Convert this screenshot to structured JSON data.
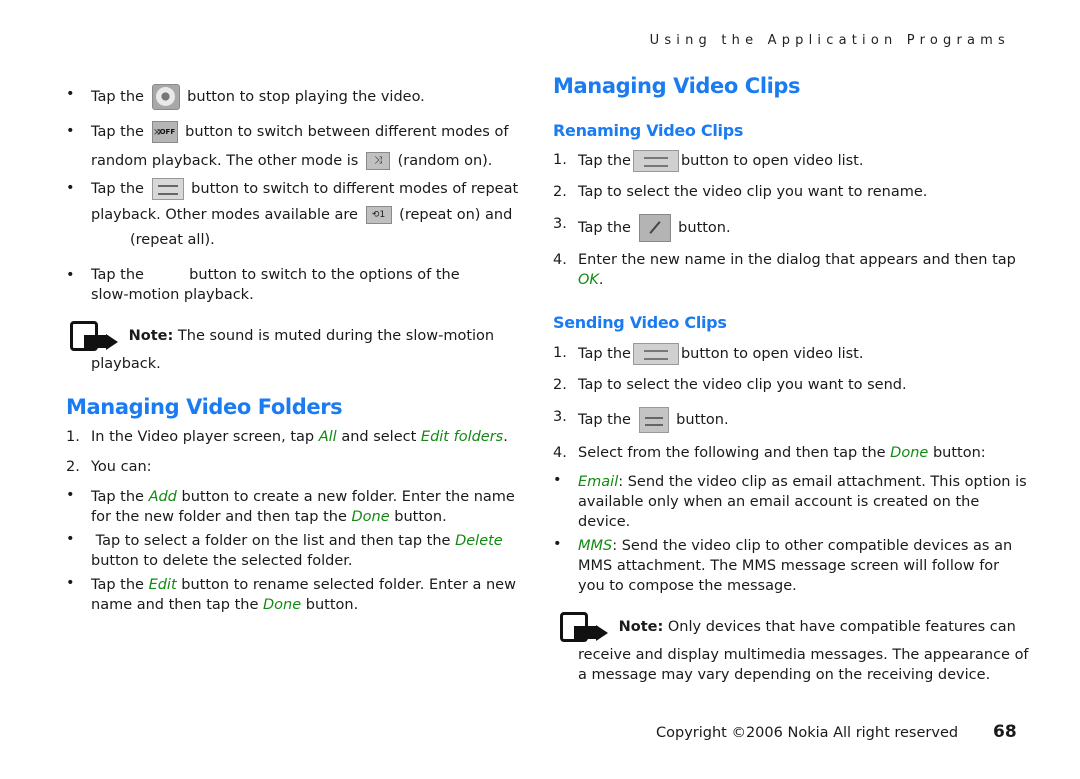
{
  "header": {
    "running_title": "Using the Application Programs"
  },
  "left": {
    "bullets_top": [
      {
        "pre": "Tap the",
        "icon": "stop-button-icon",
        "post": "button to stop playing the video."
      },
      {
        "pre": "Tap the",
        "icon": "random-off-icon",
        "icon_text": "⤨OFF",
        "post": "button to switch between different modes of",
        "line2_pre": "random playback. The other mode is",
        "icon2": "random-on-icon",
        "icon2_text": "⤨",
        "line2_post": "(random on)."
      },
      {
        "pre": "Tap the",
        "icon": "repeat-mode-icon",
        "post": "button to switch to different modes of repeat",
        "line2_pre": "playback. Other modes available are",
        "icon2": "repeat-on-icon",
        "icon2_text": "⟲1",
        "line2_post": "(repeat on) and",
        "line3": "(repeat all)."
      },
      {
        "pre": "Tap the",
        "post": "button to switch to the options of the",
        "line2": "slow-motion playback."
      }
    ],
    "note": {
      "label": "Note:",
      "text": "The sound is muted during the slow-motion",
      "text2": "playback."
    },
    "folders": {
      "title": "Managing Video Folders",
      "steps": [
        {
          "num": "1.",
          "pre": "In the Video player screen, tap",
          "em1": "All",
          "mid": "and select",
          "em2": "Edit folders",
          "post": "."
        },
        {
          "num": "2.",
          "text": "You can:"
        }
      ],
      "bullets": [
        {
          "pre": "Tap the",
          "em": "Add",
          "post": "button to create a new folder. Enter the name",
          "line2_pre": "for the new folder and then tap the",
          "em2": "Done",
          "line2_post": "button."
        },
        {
          "pre": "Tap to select a folder on the list and then tap the",
          "em": "Delete",
          "line2": "button to delete the selected folder."
        },
        {
          "pre": "Tap the",
          "em": "Edit",
          "post": "button to rename selected folder. Enter a new",
          "line2_pre": "name and then tap the",
          "em2": "Done",
          "line2_post": "button."
        }
      ]
    }
  },
  "right": {
    "title": "Managing Video Clips",
    "renaming": {
      "title": "Renaming Video Clips",
      "steps": [
        {
          "num": "1.",
          "pre": "Tap the",
          "icon": "video-list-icon",
          "post": "button to open video list."
        },
        {
          "num": "2.",
          "text": "Tap to select the video clip you want to rename."
        },
        {
          "num": "3.",
          "pre": "Tap the",
          "icon": "edit-pencil-icon",
          "post": "button."
        },
        {
          "num": "4.",
          "text": "Enter the new name in the dialog that appears and then tap",
          "em": "OK",
          "post": "."
        }
      ]
    },
    "sending": {
      "title": "Sending Video Clips",
      "steps": [
        {
          "num": "1.",
          "pre": "Tap the",
          "icon": "video-list-icon",
          "post": "button to open video list."
        },
        {
          "num": "2.",
          "text": "Tap to select the video clip you want to send."
        },
        {
          "num": "3.",
          "pre": "Tap the",
          "icon": "send-icon",
          "post": "button."
        },
        {
          "num": "4.",
          "pre": "Select from the following and then tap the",
          "em": "Done",
          "post": "button:"
        }
      ],
      "options": [
        {
          "em": "Email",
          "text": ": Send the video clip as email attachment. This option is",
          "line2": "available only when an email account is created on the",
          "line3": "device."
        },
        {
          "em": "MMS",
          "text": ": Send the video clip to other compatible devices as an",
          "line2": "MMS attachment. The MMS message screen will follow for",
          "line3": "you to compose the message."
        }
      ]
    },
    "note": {
      "label": "Note:",
      "text": "Only devices that have compatible features can",
      "text2": "receive and display multimedia messages. The appearance of",
      "text3": "a message may vary depending on the receiving device."
    }
  },
  "footer": {
    "copyright": "Copyright ©2006 Nokia All right reserved",
    "page_number": "68"
  },
  "colors": {
    "heading": "#1a7cf0",
    "emphasis": "#128a12",
    "text": "#1a1a1a"
  }
}
